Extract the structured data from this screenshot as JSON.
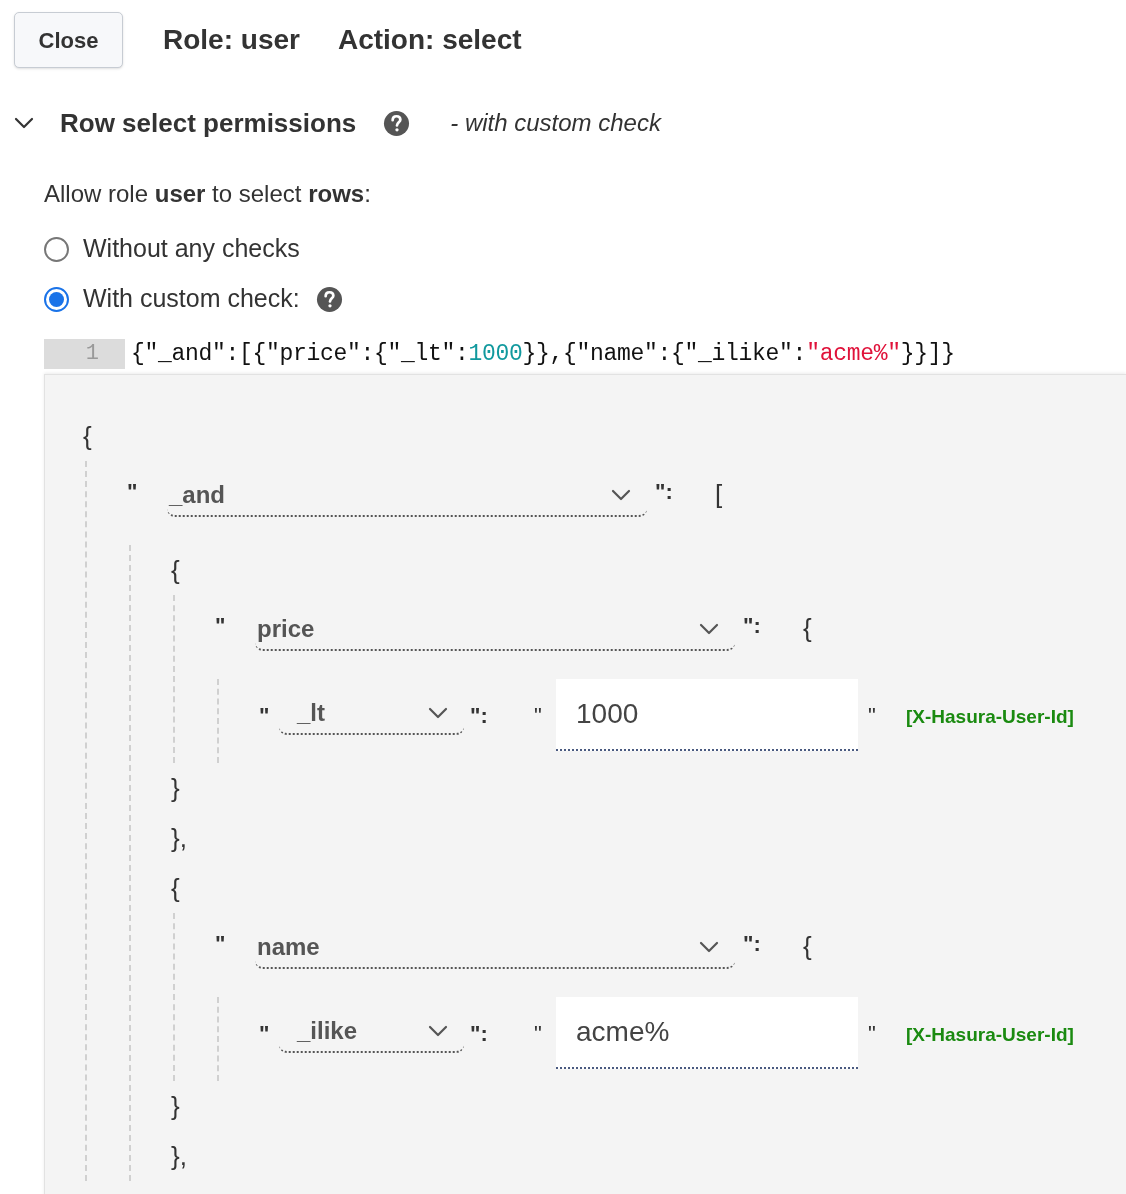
{
  "header": {
    "close_button": "Close",
    "role": "Role: user",
    "action": "Action: select"
  },
  "section": {
    "title": "Row select permissions",
    "expanded": true,
    "note": "- with custom check"
  },
  "allow_text": "Allow role **user** to select **rows**:",
  "radios": [
    {
      "label": "Without any checks",
      "selected": false,
      "help": false
    },
    {
      "label": "With custom check:",
      "selected": true,
      "help": true
    }
  ],
  "code_editor": {
    "line_number": "1",
    "tokens": [
      {
        "kind": "plain",
        "text": "{\"_and\":[{\"price\":{\"_lt\":"
      },
      {
        "kind": "number",
        "text": "1000"
      },
      {
        "kind": "plain",
        "text": "}},{\"name\":{\"_ilike\":"
      },
      {
        "kind": "string",
        "text": "\"acme%\""
      },
      {
        "kind": "plain",
        "text": "}}]}"
      }
    ]
  },
  "builder": [
    {
      "kind": "brace",
      "text": "{"
    },
    {
      "kind": "group",
      "children": [
        {
          "kind": "key",
          "quote": "\"",
          "key": "_and",
          "close": "\":",
          "bracket": "["
        },
        {
          "kind": "group",
          "children": [
            {
              "kind": "brace",
              "text": "{"
            },
            {
              "kind": "group",
              "children": [
                {
                  "kind": "key",
                  "quote": "\"",
                  "key": "price",
                  "close": "\":",
                  "bracket": "{"
                },
                {
                  "kind": "group",
                  "children": [
                    {
                      "kind": "op",
                      "quote": "\"",
                      "operator": "_lt",
                      "close": "\":",
                      "value_open": "\"",
                      "value": "1000",
                      "value_close": "\"",
                      "session_var": "[X-Hasura-User-Id]"
                    }
                  ]
                }
              ]
            },
            {
              "kind": "brace",
              "text": "}"
            },
            {
              "kind": "brace",
              "text": "},"
            },
            {
              "kind": "brace",
              "text": "{"
            },
            {
              "kind": "group",
              "children": [
                {
                  "kind": "key",
                  "quote": "\"",
                  "key": "name",
                  "close": "\":",
                  "bracket": "{"
                },
                {
                  "kind": "group",
                  "children": [
                    {
                      "kind": "op",
                      "quote": "\"",
                      "operator": "_ilike",
                      "close": "\":",
                      "value_open": "\"",
                      "value": "acme%",
                      "value_close": "\"",
                      "session_var": "[X-Hasura-User-Id]"
                    }
                  ]
                }
              ]
            },
            {
              "kind": "brace",
              "text": "}"
            },
            {
              "kind": "brace",
              "text": "},"
            }
          ]
        }
      ]
    }
  ]
}
